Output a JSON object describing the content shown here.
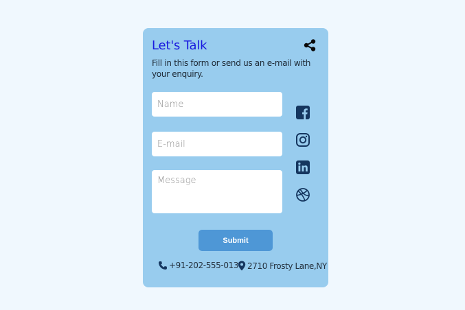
{
  "card": {
    "title": "Let's Talk",
    "subtitle": "Fill in this form or send us an e-mail with your enquiry."
  },
  "form": {
    "name_placeholder": "Name",
    "email_placeholder": "E-mail",
    "message_placeholder": "Message",
    "submit_label": "Submit"
  },
  "social": [
    "facebook-icon",
    "instagram-icon",
    "linkedin-icon",
    "dribbble-icon"
  ],
  "contact": {
    "phone": "+91-202-555-0137",
    "address": "2710 Frosty Lane,NY"
  },
  "colors": {
    "background": "#f0f8fe",
    "card": "#98ccee",
    "title": "#1a1adf",
    "button": "#4e97d6",
    "icon": "#15365f"
  }
}
